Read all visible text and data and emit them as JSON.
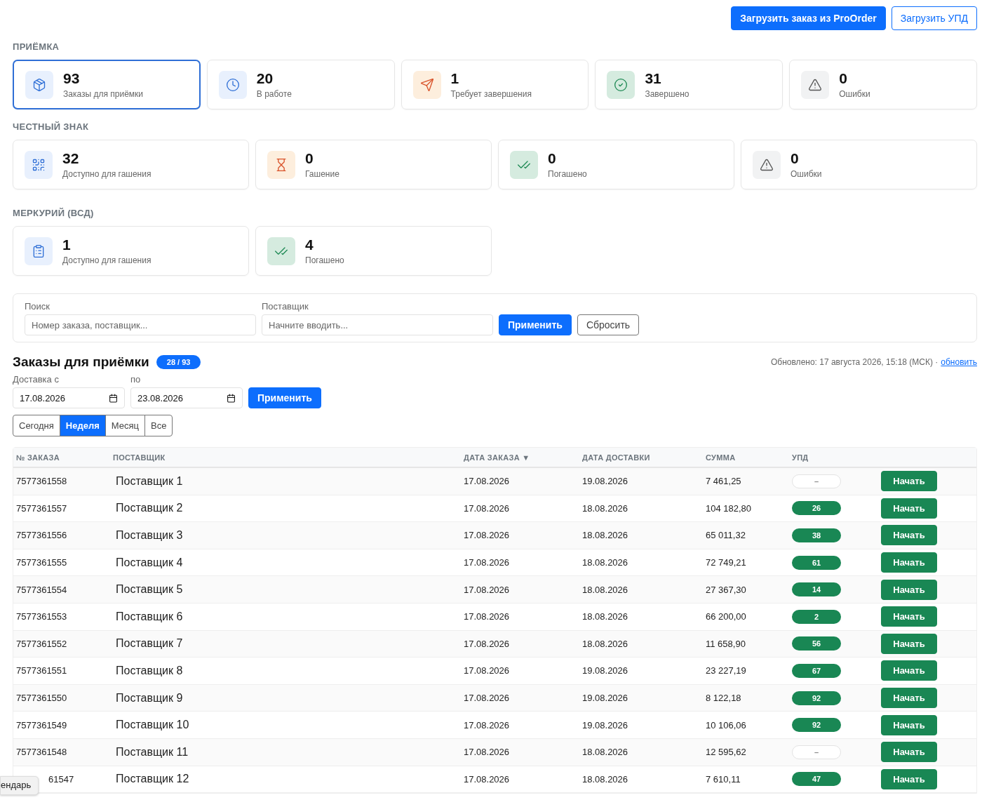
{
  "header_buttons": [
    {
      "label": "Загрузить заказ из ProOrder",
      "kind": "primary"
    },
    {
      "label": "Загрузить УПД",
      "kind": "outline"
    }
  ],
  "sections": [
    {
      "title": "ПРИЁМКА",
      "cards": [
        {
          "value": "93",
          "label": "Заказы для приёмки",
          "selected": true
        },
        {
          "value": "20",
          "label": "В работе",
          "selected": false
        },
        {
          "value": "1",
          "label": "Требует завершения",
          "selected": false
        },
        {
          "value": "31",
          "label": "Завершено",
          "selected": false
        },
        {
          "value": "0",
          "label": "Ошибки",
          "selected": false
        }
      ]
    },
    {
      "title": "ЧЕСТНЫЙ ЗНАК",
      "cards": [
        {
          "value": "32",
          "label": "Доступно для гашения",
          "selected": false
        },
        {
          "value": "0",
          "label": "Гашение",
          "selected": false
        },
        {
          "value": "0",
          "label": "Погашено",
          "selected": false
        },
        {
          "value": "0",
          "label": "Ошибки",
          "selected": false
        }
      ]
    },
    {
      "title": "МЕРКУРИЙ (ВСД)",
      "cards": [
        {
          "value": "1",
          "label": "Доступно для гашения",
          "selected": false
        },
        {
          "value": "4",
          "label": "Погашено",
          "selected": false
        }
      ]
    }
  ],
  "filters": {
    "search": {
      "label": "Поиск",
      "placeholder": "Номер заказа, поставщик..."
    },
    "supplier": {
      "label": "Поставщик",
      "placeholder": "Начните вводить..."
    },
    "apply": "Применить",
    "reset": "Сбросить"
  },
  "orders": {
    "title": "Заказы для приёмки",
    "badge": "28 / 93",
    "updated": "Обновлено: 17 августа 2026, 15:18 (МСК) ·",
    "refresh": "обновить",
    "date_from": {
      "label": "Доставка с",
      "value": "17.08.2026"
    },
    "date_to": {
      "label": "по",
      "value": "23.08.2026"
    },
    "apply": "Применить",
    "periods": [
      {
        "label": "Сегодня",
        "selected": false
      },
      {
        "label": "Неделя",
        "selected": true
      },
      {
        "label": "Месяц",
        "selected": false
      },
      {
        "label": "Все",
        "selected": false
      }
    ],
    "columns": [
      "№ ЗАКАЗА",
      "ПОСТАВЩИК",
      "ДАТА ЗАКАЗА ▼",
      "ДАТА ДОСТАВКИ",
      "СУММА",
      "УПД"
    ],
    "rows": [
      {
        "order": "7577361558",
        "supplier": "Поставщик 1",
        "order_date": "17.08.2026",
        "delivery_date": "19.08.2026",
        "sum": "7 461,25",
        "upd": {
          "kind": "empty",
          "text": "–"
        },
        "action": "Начать"
      },
      {
        "order": "7577361557",
        "supplier": "Поставщик 2",
        "order_date": "17.08.2026",
        "delivery_date": "18.08.2026",
        "sum": "104 182,80",
        "upd": {
          "kind": "count",
          "text": "26"
        },
        "action": "Начать"
      },
      {
        "order": "7577361556",
        "supplier": "Поставщик 3",
        "order_date": "17.08.2026",
        "delivery_date": "18.08.2026",
        "sum": "65 011,32",
        "upd": {
          "kind": "count",
          "text": "38"
        },
        "action": "Начать"
      },
      {
        "order": "7577361555",
        "supplier": "Поставщик 4",
        "order_date": "17.08.2026",
        "delivery_date": "18.08.2026",
        "sum": "72 749,21",
        "upd": {
          "kind": "count",
          "text": "61"
        },
        "action": "Начать"
      },
      {
        "order": "7577361554",
        "supplier": "Поставщик 5",
        "order_date": "17.08.2026",
        "delivery_date": "18.08.2026",
        "sum": "27 367,30",
        "upd": {
          "kind": "count",
          "text": "14"
        },
        "action": "Начать"
      },
      {
        "order": "7577361553",
        "supplier": "Поставщик 6",
        "order_date": "17.08.2026",
        "delivery_date": "18.08.2026",
        "sum": "66 200,00",
        "upd": {
          "kind": "count",
          "text": "2"
        },
        "action": "Начать"
      },
      {
        "order": "7577361552",
        "supplier": "Поставщик 7",
        "order_date": "17.08.2026",
        "delivery_date": "18.08.2026",
        "sum": "11 658,90",
        "upd": {
          "kind": "count",
          "text": "56"
        },
        "action": "Начать"
      },
      {
        "order": "7577361551",
        "supplier": "Поставщик 8",
        "order_date": "17.08.2026",
        "delivery_date": "19.08.2026",
        "sum": "23 227,19",
        "upd": {
          "kind": "count",
          "text": "67"
        },
        "action": "Начать"
      },
      {
        "order": "7577361550",
        "supplier": "Поставщик 9",
        "order_date": "17.08.2026",
        "delivery_date": "19.08.2026",
        "sum": "8 122,18",
        "upd": {
          "kind": "count",
          "text": "92"
        },
        "action": "Начать"
      },
      {
        "order": "7577361549",
        "supplier": "Поставщик 10",
        "order_date": "17.08.2026",
        "delivery_date": "19.08.2026",
        "sum": "10 106,06",
        "upd": {
          "kind": "count",
          "text": "92"
        },
        "action": "Начать"
      },
      {
        "order": "7577361548",
        "supplier": "Поставщик 11",
        "order_date": "17.08.2026",
        "delivery_date": "18.08.2026",
        "sum": "12 595,62",
        "upd": {
          "kind": "empty",
          "text": "–"
        },
        "action": "Начать"
      },
      {
        "order": "61547",
        "supplier": "Поставщик 12",
        "order_date": "17.08.2026",
        "delivery_date": "18.08.2026",
        "sum": "7 610,11",
        "upd": {
          "kind": "count",
          "text": "47"
        },
        "action": "Начать"
      }
    ]
  },
  "tooltip": "ендарь"
}
